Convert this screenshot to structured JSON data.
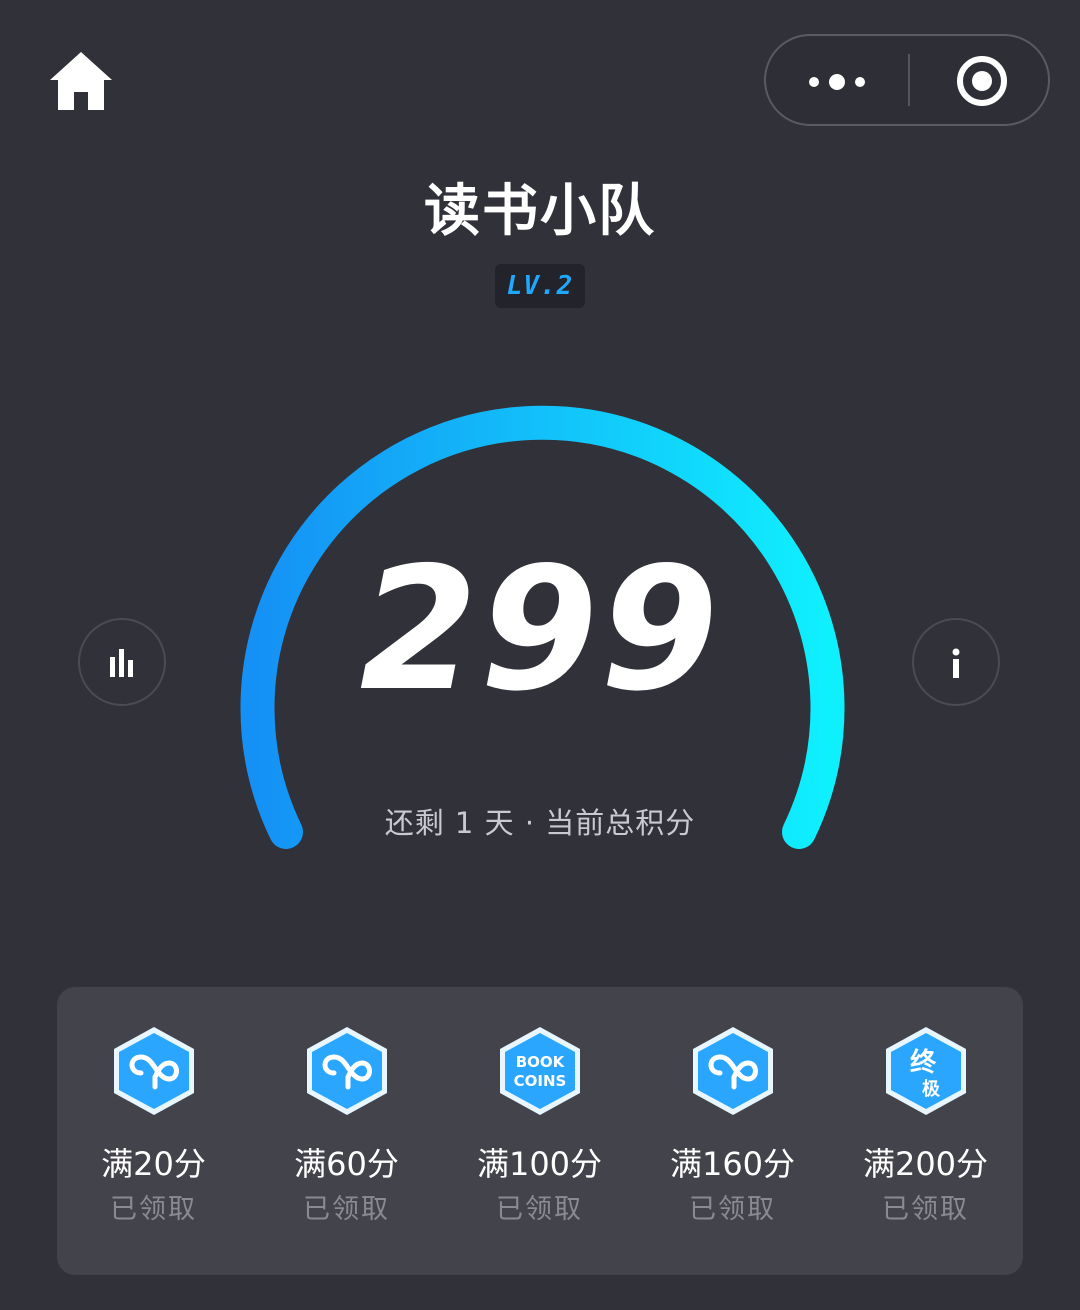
{
  "header": {
    "home_icon": "home-icon",
    "more_icon": "more-dots-icon",
    "target_icon": "target-icon"
  },
  "team": {
    "title": "读书小队",
    "level": "LV.2"
  },
  "gauge": {
    "score": "299",
    "subtext": "还剩 1 天 · 当前总积分",
    "gradient_start": "#1591f5",
    "gradient_end": "#0ff0ff",
    "left_icon": "bar-chart-icon",
    "right_icon": "info-icon"
  },
  "rewards": [
    {
      "label": "满20分",
      "status": "已领取",
      "icon": "loop-badge-icon"
    },
    {
      "label": "满60分",
      "status": "已领取",
      "icon": "loop-badge-icon"
    },
    {
      "label": "满100分",
      "status": "已领取",
      "icon": "book-coins-badge-icon",
      "badge_text": [
        "BOOK",
        "COINS"
      ]
    },
    {
      "label": "满160分",
      "status": "已领取",
      "icon": "loop-badge-icon"
    },
    {
      "label": "满200分",
      "status": "已领取",
      "icon": "ultimate-badge-icon",
      "badge_text": [
        "终",
        "极"
      ]
    }
  ]
}
